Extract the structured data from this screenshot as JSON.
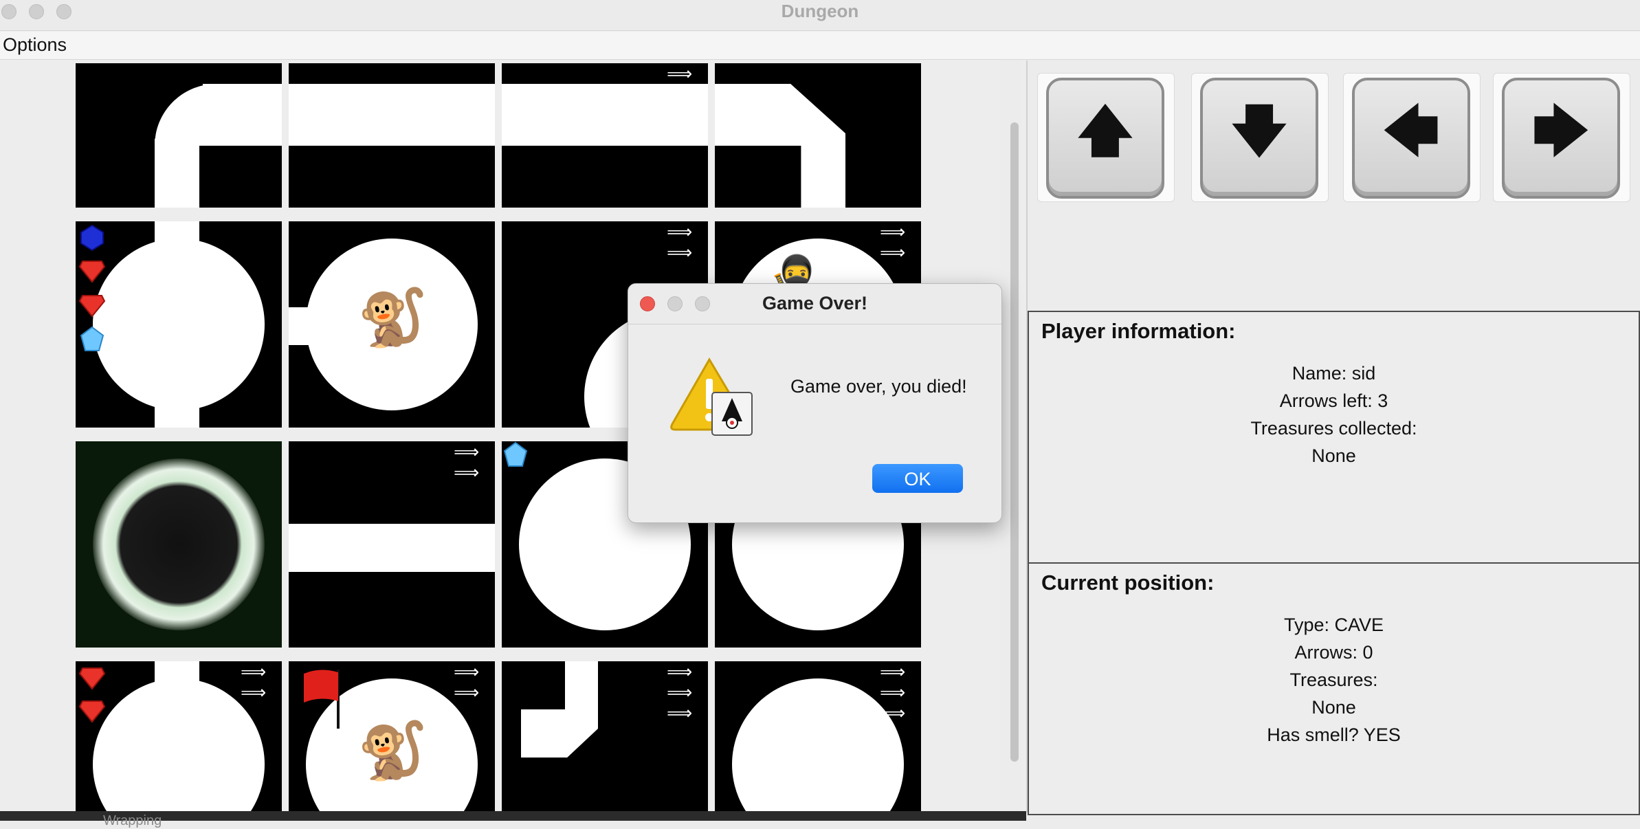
{
  "window": {
    "title": "Dungeon"
  },
  "menu": {
    "items": [
      "Options"
    ]
  },
  "controls": [
    {
      "name": "up",
      "glyph": "🡅"
    },
    {
      "name": "down",
      "glyph": "🡇"
    },
    {
      "name": "left",
      "glyph": "🡄"
    },
    {
      "name": "right",
      "glyph": "🡆"
    }
  ],
  "player_info": {
    "heading": "Player information:",
    "name": "Name: sid",
    "arrows": "Arrows left: 3",
    "treasures_label": "Treasures collected:",
    "treasures_value": "None"
  },
  "current_position": {
    "heading": "Current position:",
    "type": "Type: CAVE",
    "arrows": "Arrows: 0",
    "treasures_label": "Treasures:",
    "treasures_value": "None",
    "smell": "Has smell? YES"
  },
  "dialog": {
    "title": "Game Over!",
    "message": "Game over, you died!",
    "ok_label": "OK"
  },
  "bottom_text": "Wrapping",
  "colors": {
    "ok_button": "#1677f5",
    "map_bg": "#000000",
    "panel_border": "#4d4d4d"
  }
}
